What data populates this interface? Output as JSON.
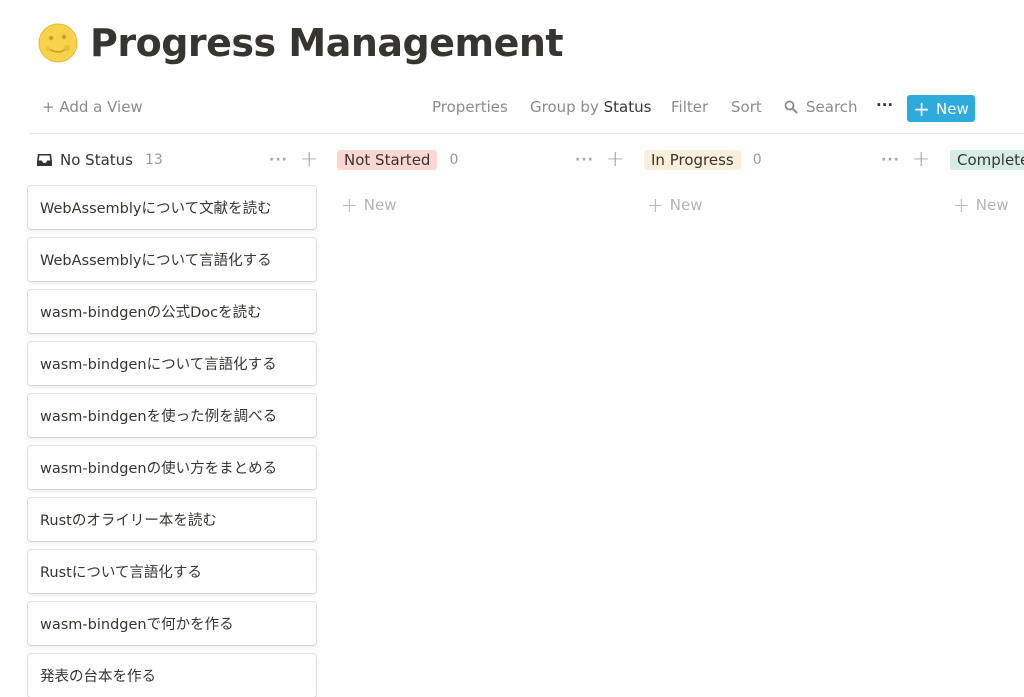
{
  "page": {
    "emoji_icon": "full-moon-face-icon",
    "title": "Progress Management"
  },
  "toolbar": {
    "add_view": "+ Add a View",
    "properties": "Properties",
    "group_by_label": "Group by",
    "group_by_value": "Status",
    "filter": "Filter",
    "sort": "Sort",
    "search": "Search",
    "more": "···",
    "new_button": "New"
  },
  "columns": [
    {
      "label": "No Status",
      "count": "13",
      "icon": "inbox-icon"
    },
    {
      "label": "Not Started",
      "count": "0",
      "color": "#ffd6d1"
    },
    {
      "label": "In Progress",
      "count": "0",
      "color": "#fbeeda"
    },
    {
      "label": "Complete",
      "color": "#d6ede4"
    }
  ],
  "column_new_label": "New",
  "cards": [
    "WebAssemblyについて文献を読む",
    "WebAssemblyについて言語化する",
    "wasm-bindgenの公式Docを読む",
    "wasm-bindgenについて言語化する",
    "wasm-bindgenを使った例を調べる",
    "wasm-bindgenの使い方をまとめる",
    "Rustのオライリー本を読む",
    "Rustについて言語化する",
    "wasm-bindgenで何かを作る",
    "発表の台本を作る"
  ],
  "colors": {
    "accent": "#2eaadc",
    "text": "#37352f",
    "muted": "#8d8b87"
  }
}
